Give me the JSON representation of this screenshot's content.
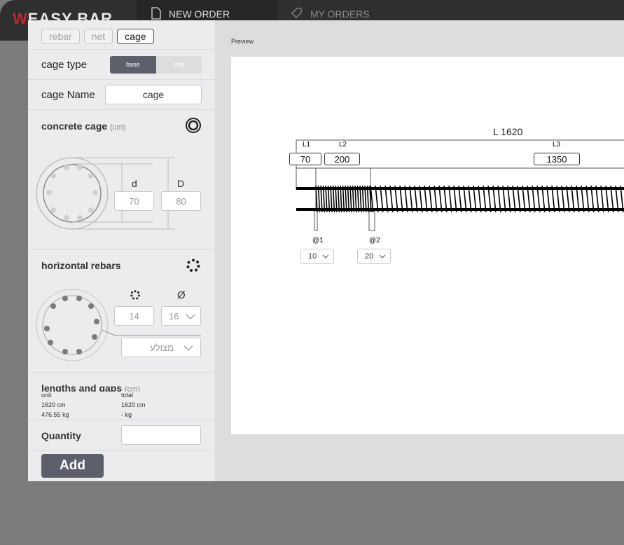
{
  "app": {
    "logo": "EASY BAR",
    "nav": [
      {
        "label": "NEW ORDER"
      },
      {
        "label": "MY ORDERS"
      }
    ]
  },
  "panel": {
    "chips": [
      "rebar",
      "net",
      "cage"
    ],
    "active_chip": "cage",
    "cage_type": {
      "label": "cage type",
      "options": [
        "base",
        "side"
      ],
      "selected": "base"
    },
    "cage_name": {
      "label": "cage Name",
      "value": "cage"
    },
    "concrete_cage": {
      "title": "concrete cage",
      "unit": "(cm)",
      "d_label": "d",
      "D_label": "D",
      "d_value": "70",
      "D_value": "80"
    },
    "horizontal_rebars": {
      "title": "horizontal rebars",
      "count": "14",
      "diameter": "16",
      "diameter_symbol": "Ø",
      "type_placeholder": "מצולע"
    },
    "lengths": {
      "title": "lengths and gaps",
      "unit": "(cm)"
    },
    "summary": {
      "unit_label": "unit",
      "total_label": "total",
      "unit_length": "1620 cm",
      "total_length": "1620 cm",
      "unit_weight": "476.55 kg",
      "total_weight": "- kg"
    },
    "quantity": {
      "label": "Quantity",
      "value": ""
    },
    "add_label": "Add"
  },
  "preview": {
    "title": "Preview",
    "total_label": "L 1620",
    "segments": [
      {
        "label": "L1",
        "value": "70"
      },
      {
        "label": "L2",
        "value": "200"
      },
      {
        "label": "L3",
        "value": "1350"
      }
    ],
    "spacings": [
      {
        "label": "@1",
        "value": "10"
      },
      {
        "label": "@2",
        "value": "20"
      }
    ]
  }
}
